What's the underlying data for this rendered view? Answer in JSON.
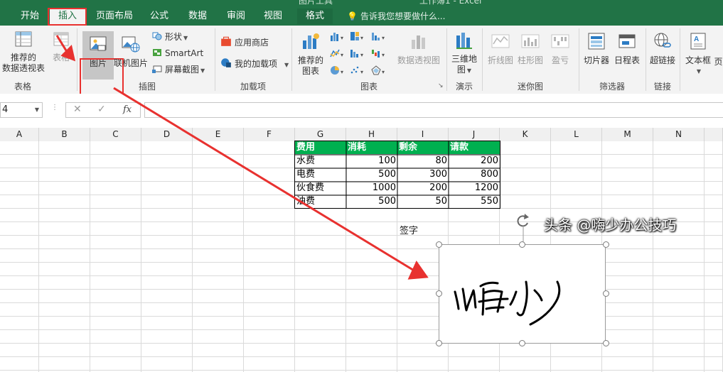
{
  "title_bar": {
    "context_group": "图片工具",
    "document_title": "工作簿1 - Excel"
  },
  "tabs": [
    "开始",
    "插入",
    "页面布局",
    "公式",
    "数据",
    "审阅",
    "视图",
    "格式"
  ],
  "active_tab": "插入",
  "tell_me": "告诉我您想要做什么...",
  "ribbon": {
    "groups": {
      "tables": "表格",
      "illustrations": "插图",
      "addins": "加载项",
      "charts": "图表",
      "tours": "演示",
      "sparklines": "迷你图",
      "filters": "筛选器",
      "links": "链接"
    },
    "buttons": {
      "recommended_pivot_line1": "推荐的",
      "recommended_pivot_line2": "数据透视表",
      "table": "表格",
      "picture": "图片",
      "online_picture": "联机图片",
      "shapes": "形状",
      "smartart": "SmartArt",
      "screenshot": "屏幕截图",
      "store": "应用商店",
      "my_addins": "我的加载项",
      "recommended_charts_line1": "推荐的",
      "recommended_charts_line2": "图表",
      "pivot_chart": "数据透视图",
      "map3d_line1": "三维地",
      "map3d_line2": "图",
      "spark_line": "折线图",
      "spark_column": "柱形图",
      "spark_winloss": "盈亏",
      "slicer": "切片器",
      "timeline": "日程表",
      "hyperlink": "超链接",
      "textbox": "文本框",
      "more": "页"
    }
  },
  "formula_bar": {
    "name_box": "4",
    "cancel": "✕",
    "enter": "✓",
    "fx": "fx",
    "value": ""
  },
  "columns": [
    "A",
    "B",
    "C",
    "D",
    "E",
    "F",
    "G",
    "H",
    "I",
    "J",
    "K",
    "L",
    "M",
    "N"
  ],
  "table": {
    "headers": [
      "费用",
      "消耗",
      "剩余",
      "请款"
    ],
    "rows": [
      [
        "水费",
        "100",
        "80",
        "200"
      ],
      [
        "电费",
        "500",
        "300",
        "800"
      ],
      [
        "伙食费",
        "1000",
        "200",
        "1200"
      ],
      [
        "油费",
        "500",
        "50",
        "550"
      ]
    ]
  },
  "signature": {
    "label": "签字",
    "image_text": "嗨少"
  },
  "watermark": "头条 @嗨少办公技巧",
  "colors": {
    "excel_green": "#217346",
    "header_fill": "#00b050",
    "highlight_red": "#e8312f"
  }
}
